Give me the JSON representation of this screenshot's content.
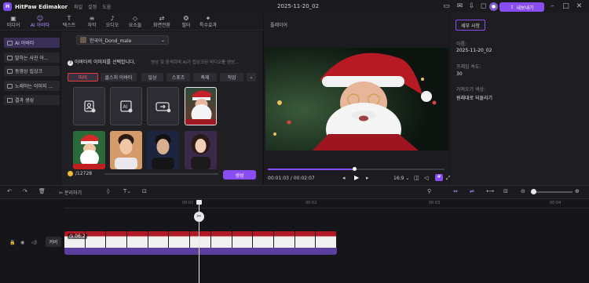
{
  "app": {
    "name": "HitPaw Edimakor",
    "menu": [
      "파일",
      "설정",
      "도움"
    ],
    "date_title": "2025-11-20_02",
    "export_label": "내보내기"
  },
  "tabs": [
    {
      "icon": "media-icon",
      "label": "미디어"
    },
    {
      "icon": "ai-icon",
      "label": "AI 아바타",
      "active": true
    },
    {
      "icon": "text-icon",
      "label": "텍스트"
    },
    {
      "icon": "subtitle-icon",
      "label": "자막"
    },
    {
      "icon": "audio-icon",
      "label": "오디오"
    },
    {
      "icon": "elements-icon",
      "label": "요소들"
    },
    {
      "icon": "transition-icon",
      "label": "화면전환"
    },
    {
      "icon": "filter-icon",
      "label": "필터"
    },
    {
      "icon": "effects-icon",
      "label": "특수효과"
    }
  ],
  "sidebar": {
    "items": [
      "AI 아바타",
      "말하는 사진 아…",
      "동영상 립싱크",
      "노래하는 이미지 …",
      "결과 생성"
    ]
  },
  "avatar": {
    "voice": "한국어_Dond_male",
    "step_label": "아바타의 이미지를 선택합니다.",
    "step_hint": "영상 및 음색하며 AI가 립싱크된 비디오를 생성...",
    "filters": [
      "마이",
      "클스처 아바타",
      "일상",
      "스포츠",
      "축제",
      "직업"
    ],
    "credits": "/12728",
    "generate_label": "생성"
  },
  "player": {
    "title": "플레이어",
    "current": "00:01:03",
    "total": "00:02:07",
    "ratio": "16:9",
    "progress": 0.49
  },
  "props": {
    "tab": "세부 사항",
    "name_label": "이름:",
    "name_value": "2025-11-20_02",
    "fps_label": "프레임 속도:",
    "fps_value": "30",
    "color_label": "가져오기 색상:",
    "color_value": "원래대로 되돌리기"
  },
  "toolbar2": {
    "split_label": "분리하기"
  },
  "timeline": {
    "ticks": [
      "00:01",
      "00:02",
      "00:03",
      "00:04"
    ],
    "track_label": "커버",
    "clip_time": "06:2"
  },
  "colors": {
    "accent": "#8a4df5",
    "highlight": "#e23c3c"
  }
}
